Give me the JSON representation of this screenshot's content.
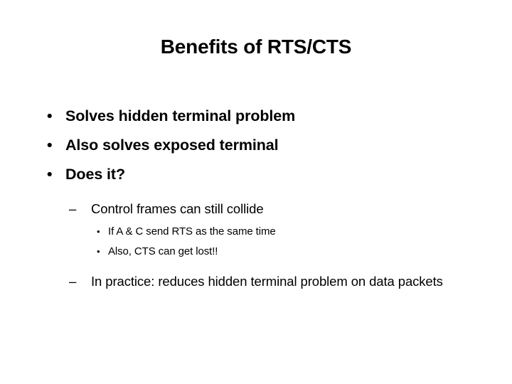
{
  "slide": {
    "title": "Benefits of RTS/CTS",
    "background_color": "#ffffff",
    "text_color": "#000000",
    "bullets": [
      {
        "level": 1,
        "marker": "•",
        "text": "Solves hidden terminal problem"
      },
      {
        "level": 1,
        "marker": "•",
        "text": "Also solves exposed terminal"
      },
      {
        "level": 1,
        "marker": "•",
        "text": "Does it?"
      },
      {
        "level": 2,
        "marker": "–",
        "text": "Control frames can still collide"
      },
      {
        "level": 3,
        "marker": "•",
        "text": "If A & C send RTS as the same time"
      },
      {
        "level": 3,
        "marker": "•",
        "text": "Also, CTS can get lost!!"
      },
      {
        "level": 2,
        "marker": "–",
        "text": "In practice: reduces hidden terminal problem on data packets"
      }
    ]
  }
}
